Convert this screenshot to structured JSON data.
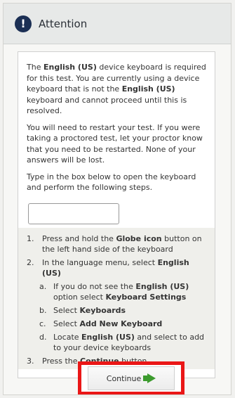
{
  "header": {
    "icon": "alert-icon",
    "title": "Attention"
  },
  "message": {
    "p1": [
      "The ",
      "English (US)",
      " device keyboard is required for this test. You are currently using a device keyboard that is not the ",
      "English (US)",
      " keyboard and cannot proceed until this is resolved."
    ],
    "p2": "You will need to restart your test. If you were taking a proctored test, let your proctor know that you need to be restarted. None of your answers will be lost.",
    "p3": "Type in the box below to open the keyboard and perform the following steps."
  },
  "steps": {
    "s1": {
      "num": "1.",
      "parts": [
        "Press and hold the ",
        "Globe icon",
        " button on the left hand side of the keyboard"
      ]
    },
    "s2": {
      "num": "2.",
      "parts": [
        "In the language menu, select ",
        "English (US)"
      ]
    },
    "sa": {
      "letter": "a.",
      "parts": [
        "If you do not see the ",
        "English (US)",
        " option select ",
        "Keyboard Settings"
      ]
    },
    "sb": {
      "letter": "b.",
      "parts": [
        "Select ",
        "Keyboards"
      ]
    },
    "sc": {
      "letter": "c.",
      "parts": [
        "Select ",
        "Add New Keyboard"
      ]
    },
    "sd": {
      "letter": "d.",
      "parts": [
        "Locate ",
        "English (US)",
        " and select to add to your device keyboards"
      ]
    },
    "s3": {
      "num": "3.",
      "parts": [
        "Press the ",
        "Continue",
        " button"
      ]
    }
  },
  "continue_label": "Continue",
  "colors": {
    "highlight": "#ea1717",
    "arrow": "#3c9b2e",
    "icon": "#1b2f54"
  }
}
